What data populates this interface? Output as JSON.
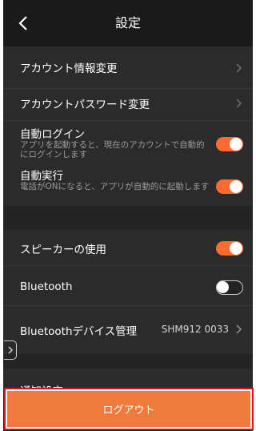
{
  "header": {
    "title": "設定"
  },
  "rows": {
    "account_info": {
      "label": "アカウント情報変更"
    },
    "account_password": {
      "label": "アカウントパスワード変更"
    },
    "auto_login": {
      "label": "自動ログイン",
      "sub": "アプリを起動すると、現在のアカウントで自動的にログインします",
      "state": "on"
    },
    "auto_run": {
      "label": "自動実行",
      "sub": "電話がONになると、アプリが自動的に起動します",
      "state": "on"
    },
    "speaker": {
      "label": "スピーカーの使用",
      "state": "on"
    },
    "bluetooth": {
      "label": "Bluetooth",
      "state": "off"
    },
    "bt_devices": {
      "label": "Bluetoothデバイス管理",
      "value": "SHM912 0033"
    },
    "notification": {
      "label": "通知設定"
    }
  },
  "logout": {
    "label": "ログアウト"
  },
  "colors": {
    "accent": "#ff6a30",
    "logout_bg": "#ee7a3e",
    "highlight_border": "#e0101a"
  }
}
